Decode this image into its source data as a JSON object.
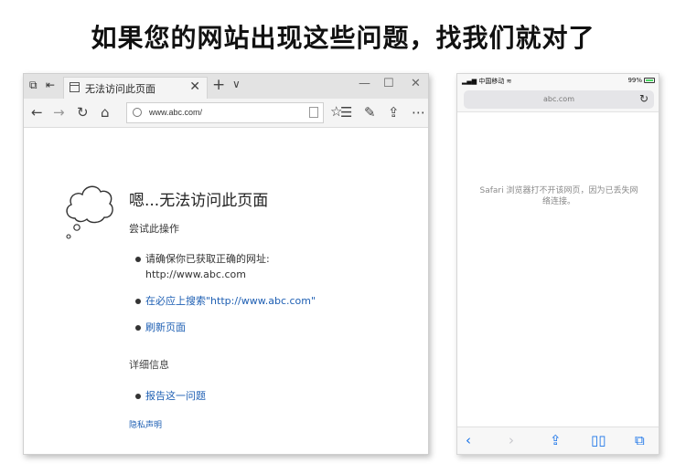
{
  "headline": "如果您的网站出现这些问题，找我们就对了",
  "edge": {
    "tab_title": "无法访问此页面",
    "tab_close": "✕",
    "new_tab": "+",
    "tab_menu": "∨",
    "win_min": "—",
    "win_max": "☐",
    "win_close": "✕",
    "address": "www.abc.com/",
    "error_title": "嗯...无法访问此页面",
    "try_label": "尝试此操作",
    "items": [
      {
        "text_line1": "请确保你已获取正确的网址:",
        "text_line2": "http://www.abc.com"
      },
      {
        "text": "在必应上搜索\"http://www.abc.com\""
      },
      {
        "text": "刷新页面"
      }
    ],
    "details_label": "详细信息",
    "report": "报告这一问题",
    "privacy": "隐私声明"
  },
  "phone": {
    "carrier": "中国移动",
    "battery": "99%",
    "url": "abc.com",
    "message": "Safari 浏览器打不开该网页，因为已丢失网络连接。"
  },
  "icons": {
    "edge": [
      "tab-list-icon",
      "tab-aside-icon",
      "page-icon",
      "back-icon",
      "forward-icon",
      "refresh-icon",
      "home-icon",
      "info-icon",
      "reading-view-icon",
      "favorite-star-icon",
      "favorites-hub-icon",
      "pen-icon",
      "share-icon",
      "more-icon",
      "cloud-icon"
    ],
    "phone": [
      "signal-icon",
      "wifi-icon",
      "battery-icon",
      "reload-icon",
      "back-icon",
      "forward-icon",
      "share-icon",
      "bookmarks-icon",
      "tabs-icon"
    ]
  },
  "colors": {
    "link": "#1e5fb3",
    "safari_accent": "#1b74e8",
    "titlebar": "#e3e3e3"
  }
}
